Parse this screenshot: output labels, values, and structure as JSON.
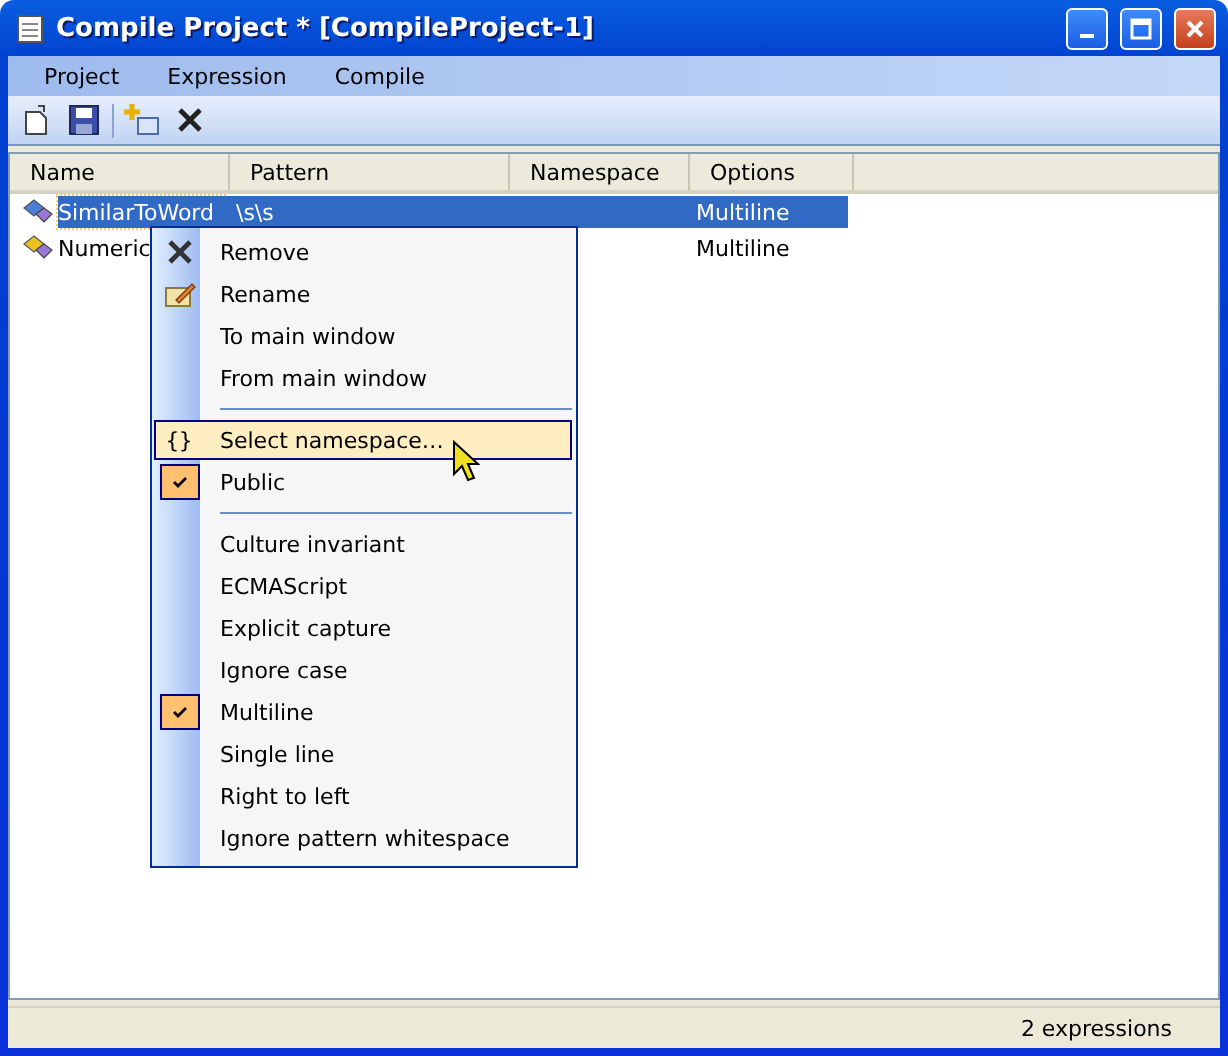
{
  "window": {
    "title": "Compile Project * [CompileProject-1]"
  },
  "menu": [
    "Project",
    "Expression",
    "Compile"
  ],
  "toolbar": [
    {
      "kind": "new"
    },
    {
      "kind": "save"
    },
    {
      "kind": "separator"
    },
    {
      "kind": "add"
    },
    {
      "kind": "delete"
    }
  ],
  "table": {
    "columns": [
      "Name",
      "Pattern",
      "Namespace",
      "Options"
    ],
    "rows": [
      {
        "name": "SimilarToWord",
        "pattern": "\\s\\s",
        "options": "Multiline",
        "selected": true
      },
      {
        "name": "Numeric",
        "options": "Multiline",
        "selected": false
      }
    ]
  },
  "context_menu": [
    {
      "kind": "remove",
      "label": "Remove",
      "selected": false
    },
    {
      "kind": "rename",
      "label": "Rename",
      "selected": false
    },
    {
      "kind": "item",
      "label": "To main window",
      "selected": false
    },
    {
      "kind": "item",
      "label": "From main window",
      "selected": false
    },
    {
      "kind": "separator"
    },
    {
      "kind": "item",
      "label": "Select namespace…",
      "glyph": "{}",
      "selected": true
    },
    {
      "kind": "item",
      "label": "Public",
      "checked": true,
      "selected": false
    },
    {
      "kind": "separator"
    },
    {
      "kind": "item",
      "label": "Culture invariant",
      "checked": false,
      "selected": false
    },
    {
      "kind": "item",
      "label": "ECMAScript",
      "checked": false,
      "selected": false
    },
    {
      "kind": "item",
      "label": "Explicit capture",
      "checked": false,
      "selected": false
    },
    {
      "kind": "item",
      "label": "Ignore case",
      "checked": false,
      "selected": false
    },
    {
      "kind": "item",
      "label": "Multiline",
      "checked": true,
      "selected": false
    },
    {
      "kind": "item",
      "label": "Single line",
      "checked": false,
      "selected": false
    },
    {
      "kind": "item",
      "label": "Right to left",
      "checked": false,
      "selected": false
    },
    {
      "kind": "item",
      "label": "Ignore pattern whitespace",
      "checked": false,
      "selected": false
    }
  ],
  "status_bar": "2 expressions"
}
